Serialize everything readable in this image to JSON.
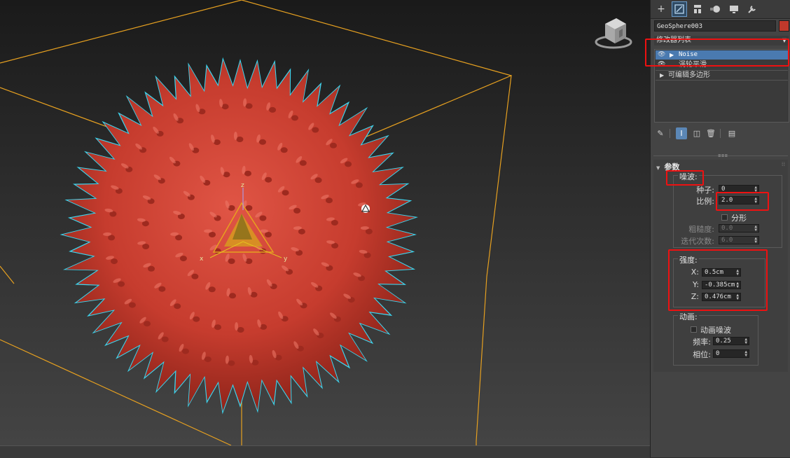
{
  "viewport": {
    "object_color": "#c63c2e",
    "selection_color": "#3bd6f0",
    "bbox_color": "#e6a020",
    "axis_labels": {
      "x": "x",
      "y": "y",
      "z": "z"
    }
  },
  "panel": {
    "tabs": [
      {
        "icon": "plus-icon",
        "glyph": "+"
      },
      {
        "icon": "modify-icon",
        "glyph": "◩"
      },
      {
        "icon": "hierarchy-icon",
        "glyph": "▆"
      },
      {
        "icon": "motion-icon",
        "glyph": "●"
      },
      {
        "icon": "display-icon",
        "glyph": "▬"
      },
      {
        "icon": "utilities-icon",
        "glyph": "🔧"
      }
    ],
    "object_name": "GeoSphere003",
    "object_color": "#c0392b",
    "modifier_list_label": "修改器列表",
    "stack": [
      {
        "label": "Noise",
        "selected": true
      },
      {
        "label": "涡轮平滑",
        "selected": false
      },
      {
        "label": "可编辑多边形",
        "selected": false
      }
    ],
    "stack_tools": [
      "pin-icon",
      "show-end-result-icon",
      "make-unique-icon",
      "remove-modifier-icon",
      "configure-icon"
    ],
    "rollout": {
      "title": "参数",
      "noise_group": {
        "title": "噪波:",
        "seed_label": "种子:",
        "seed_value": "0",
        "scale_label": "比例:",
        "scale_value": "2.0",
        "fractal_label": "分形",
        "roughness_label": "粗糙度:",
        "roughness_value": "0.0",
        "iterations_label": "迭代次数:",
        "iterations_value": "6.0"
      },
      "strength_group": {
        "title": "强度:",
        "x_label": "X:",
        "x_value": "0.5cm",
        "y_label": "Y:",
        "y_value": "-0.385cm",
        "z_label": "Z:",
        "z_value": "0.476cm"
      },
      "animation_group": {
        "title": "动画:",
        "animate_label": "动画噪波",
        "frequency_label": "频率:",
        "frequency_value": "0.25",
        "phase_label": "相位:",
        "phase_value": "0"
      }
    }
  }
}
